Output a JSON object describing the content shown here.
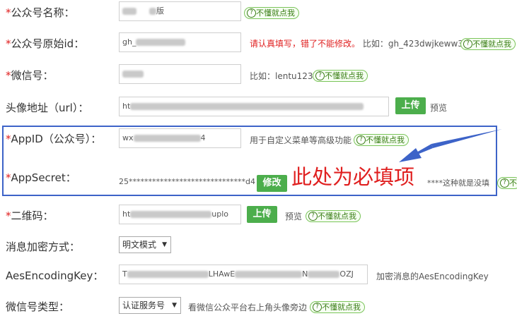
{
  "help_label": "不懂就点我",
  "fields": {
    "name": {
      "label": "公众号名称：",
      "value_suffix": "版"
    },
    "origid": {
      "label": "公众号原始id：",
      "value": "gh_",
      "warn": "请认真填写，错了不能修改。",
      "example": "比如：gh_423dwjkeww3"
    },
    "wechat": {
      "label": "微信号：",
      "example": "比如：lentu123"
    },
    "avatar": {
      "label": "头像地址（url）：",
      "value": "ht",
      "upload": "上传",
      "preview": "预览"
    },
    "appid": {
      "label": "AppID（公众号）：",
      "value_prefix": "wx",
      "value_suffix": "4",
      "hint": "用于自定义菜单等高级功能"
    },
    "appsecret": {
      "label": "AppSecret：",
      "value": "25******************************d4",
      "edit": "修改",
      "hint": "****这种就是没填",
      "help_partial": "不懂"
    },
    "qrcode": {
      "label": "二维码：",
      "value_prefix": "ht",
      "value_suffix": "uplo",
      "upload": "上传",
      "preview": "预览"
    },
    "encrypt": {
      "label": "消息加密方式：",
      "selected": "明文模式"
    },
    "aeskey": {
      "label": "AesEncodingKey：",
      "value_prefix": "T",
      "value_mid": "LHAwE",
      "value_mid2": "N",
      "value_suffix": "OZJ",
      "hint": "加密消息的AesEncodingKey"
    },
    "type": {
      "label": "微信号类型：",
      "selected": "认证服务号",
      "hint": "看微信公众平台右上角头像旁边"
    }
  },
  "annotation": {
    "text": "此处为必填项"
  },
  "colors": {
    "required": "#e02020",
    "button": "#4cae4c",
    "help": "#3a7d16",
    "box": "#3d63c8",
    "annotation": "#e02020"
  }
}
